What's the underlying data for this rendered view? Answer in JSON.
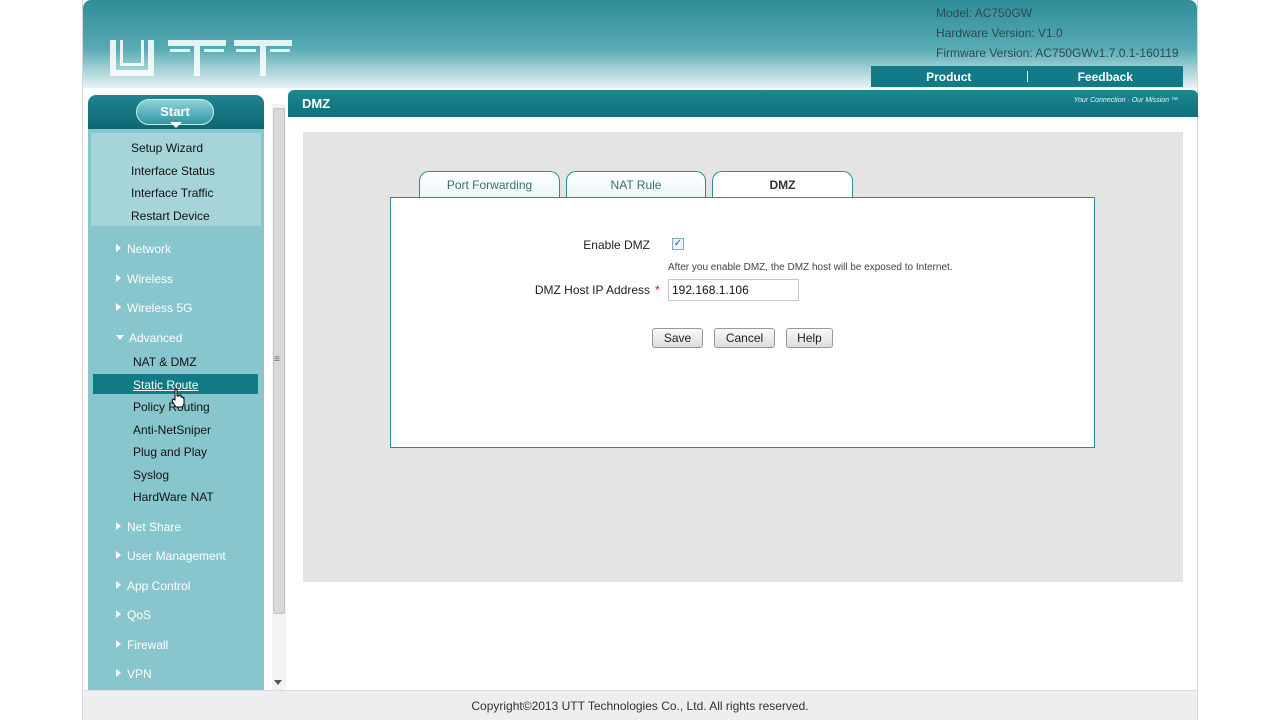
{
  "header": {
    "model": "Model: AC750GW",
    "hardware_version": "Hardware Version: V1.0",
    "firmware_version": "Firmware Version: AC750GWv1.7.0.1-160119",
    "nav": {
      "product": "Product",
      "feedback": "Feedback"
    },
    "logo_icon": "utt-logo-icon"
  },
  "sidebar": {
    "start_label": "Start",
    "start_items": [
      "Setup Wizard",
      "Interface Status",
      "Interface Traffic",
      "Restart Device"
    ],
    "categories": {
      "network": "Network",
      "wireless": "Wireless",
      "wireless5g": "Wireless 5G",
      "advanced": "Advanced",
      "net_share": "Net Share",
      "user_management": "User Management",
      "app_control": "App Control",
      "qos": "QoS",
      "firewall": "Firewall",
      "vpn": "VPN"
    },
    "advanced_items": {
      "nat_dmz": "NAT & DMZ",
      "static_route": "Static Route",
      "policy_routing": "Policy Routing",
      "anti_netsniper": "Anti-NetSniper",
      "plug_and_play": "Plug and Play",
      "syslog": "Syslog",
      "hardware_nat": "HardWare NAT"
    }
  },
  "splitter": {
    "grip": "≡"
  },
  "content": {
    "title": "DMZ",
    "brand_tag": "Your Connection · Our Mission ™",
    "tabs": [
      "Port Forwarding",
      "NAT Rule",
      "DMZ"
    ],
    "active_tab": "DMZ",
    "form": {
      "enable_label": "Enable DMZ",
      "enable_checked": "✓",
      "note": "After you enable DMZ, the DMZ host will be exposed to Internet.",
      "ip_label": "DMZ Host IP Address",
      "required": "*",
      "ip_value": "192.168.1.106"
    },
    "buttons": {
      "save": "Save",
      "cancel": "Cancel",
      "help": "Help"
    }
  },
  "footer": {
    "copyright": "Copyright©2013 UTT Technologies Co., Ltd. All rights reserved."
  },
  "colors": {
    "accent": "#127a86",
    "sidebar_bg": "#87c6cc",
    "panel_border": "#2a8c97"
  }
}
